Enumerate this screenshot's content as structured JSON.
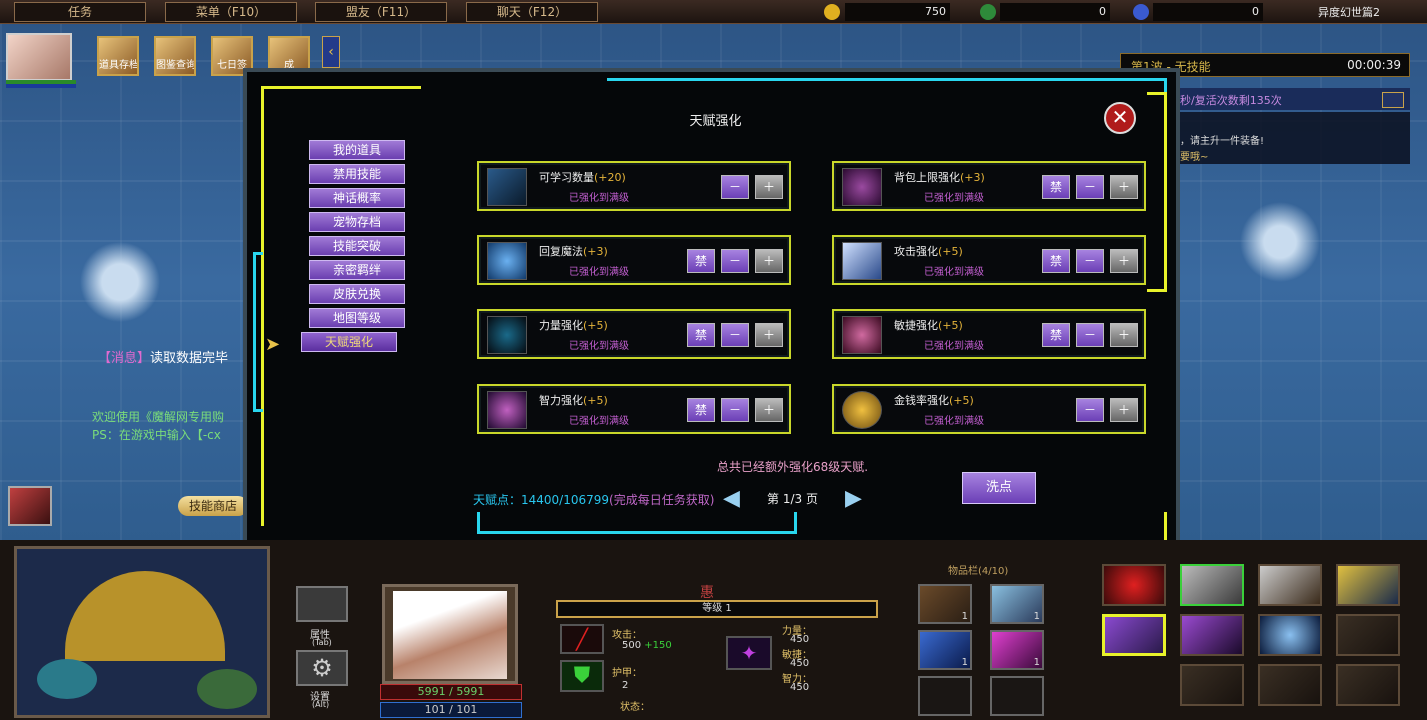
{
  "topbar": {
    "quest": "任务",
    "menu": "菜单（F10）",
    "allies": "盟友（F11）",
    "chat": "聊天（F12）",
    "gold": "750",
    "lumber": "0",
    "food": "0",
    "map_name": "异度幻世篇2"
  },
  "shortcut_tiles": [
    "道具存档",
    "图鉴查询",
    "七日签",
    "成"
  ],
  "timer_panel": {
    "wave": "第1波 - 无技能",
    "time": "00:00:39",
    "revive": "秒/复活次数剩135次",
    "tip1": "，请主升一件装备!",
    "tip2": "要哦~"
  },
  "messages": {
    "loaded_tag": "【消息】",
    "loaded_text": "读取数据完毕",
    "welcome": "欢迎使用《魔解网专用购",
    "ps": "PS：在游戏中输入【-cx"
  },
  "skill_shop": "技能商店",
  "dialog": {
    "title": "天赋强化",
    "menu": [
      "我的道具",
      "禁用技能",
      "神话概率",
      "宠物存档",
      "技能突破",
      "亲密羁绊",
      "皮肤兑换",
      "地图等级",
      "天赋强化"
    ],
    "cards": [
      {
        "name": "可学习数量",
        "bonus": "(+20)",
        "status": "已强化到满级"
      },
      {
        "name": "背包上限强化",
        "bonus": "(+3)",
        "status": "已强化到满级"
      },
      {
        "name": "回复魔法",
        "bonus": "(+3)",
        "status": "已强化到满级"
      },
      {
        "name": "攻击强化",
        "bonus": "(+5)",
        "status": "已强化到满级"
      },
      {
        "name": "力量强化",
        "bonus": "(+5)",
        "status": "已强化到满级"
      },
      {
        "name": "敏捷强化",
        "bonus": "(+5)",
        "status": "已强化到满级"
      },
      {
        "name": "智力强化",
        "bonus": "(+5)",
        "status": "已强化到满级"
      },
      {
        "name": "金钱率强化",
        "bonus": "(+5)",
        "status": "已强化到满级"
      }
    ],
    "ban": "禁",
    "minus": "－",
    "plus": "＋",
    "total": "总共已经额外强化68级天赋.",
    "points": "天赋点：14400/106799",
    "points_hint": "(完成每日任务获取)",
    "page": "第 1/3 页",
    "reset": "洗点"
  },
  "hud": {
    "attr_label": "属性",
    "attr_key": "(Tab)",
    "settings_label": "设置",
    "settings_key": "(Alt)",
    "hp": "5991 / 5991",
    "mp": "101 / 101",
    "hero_name": "惠",
    "level": "等级 1",
    "attack_label": "攻击：",
    "attack": "500",
    "attack_bonus": "+150",
    "armor_label": "护甲：",
    "armor": "2",
    "status_label": "状态：",
    "str_label": "力量：",
    "str": "450",
    "agi_label": "敏捷：",
    "agi": "450",
    "int_label": "智力：",
    "int": "450",
    "slot_count": "1",
    "inventory_label": "物品栏(4/10)"
  }
}
